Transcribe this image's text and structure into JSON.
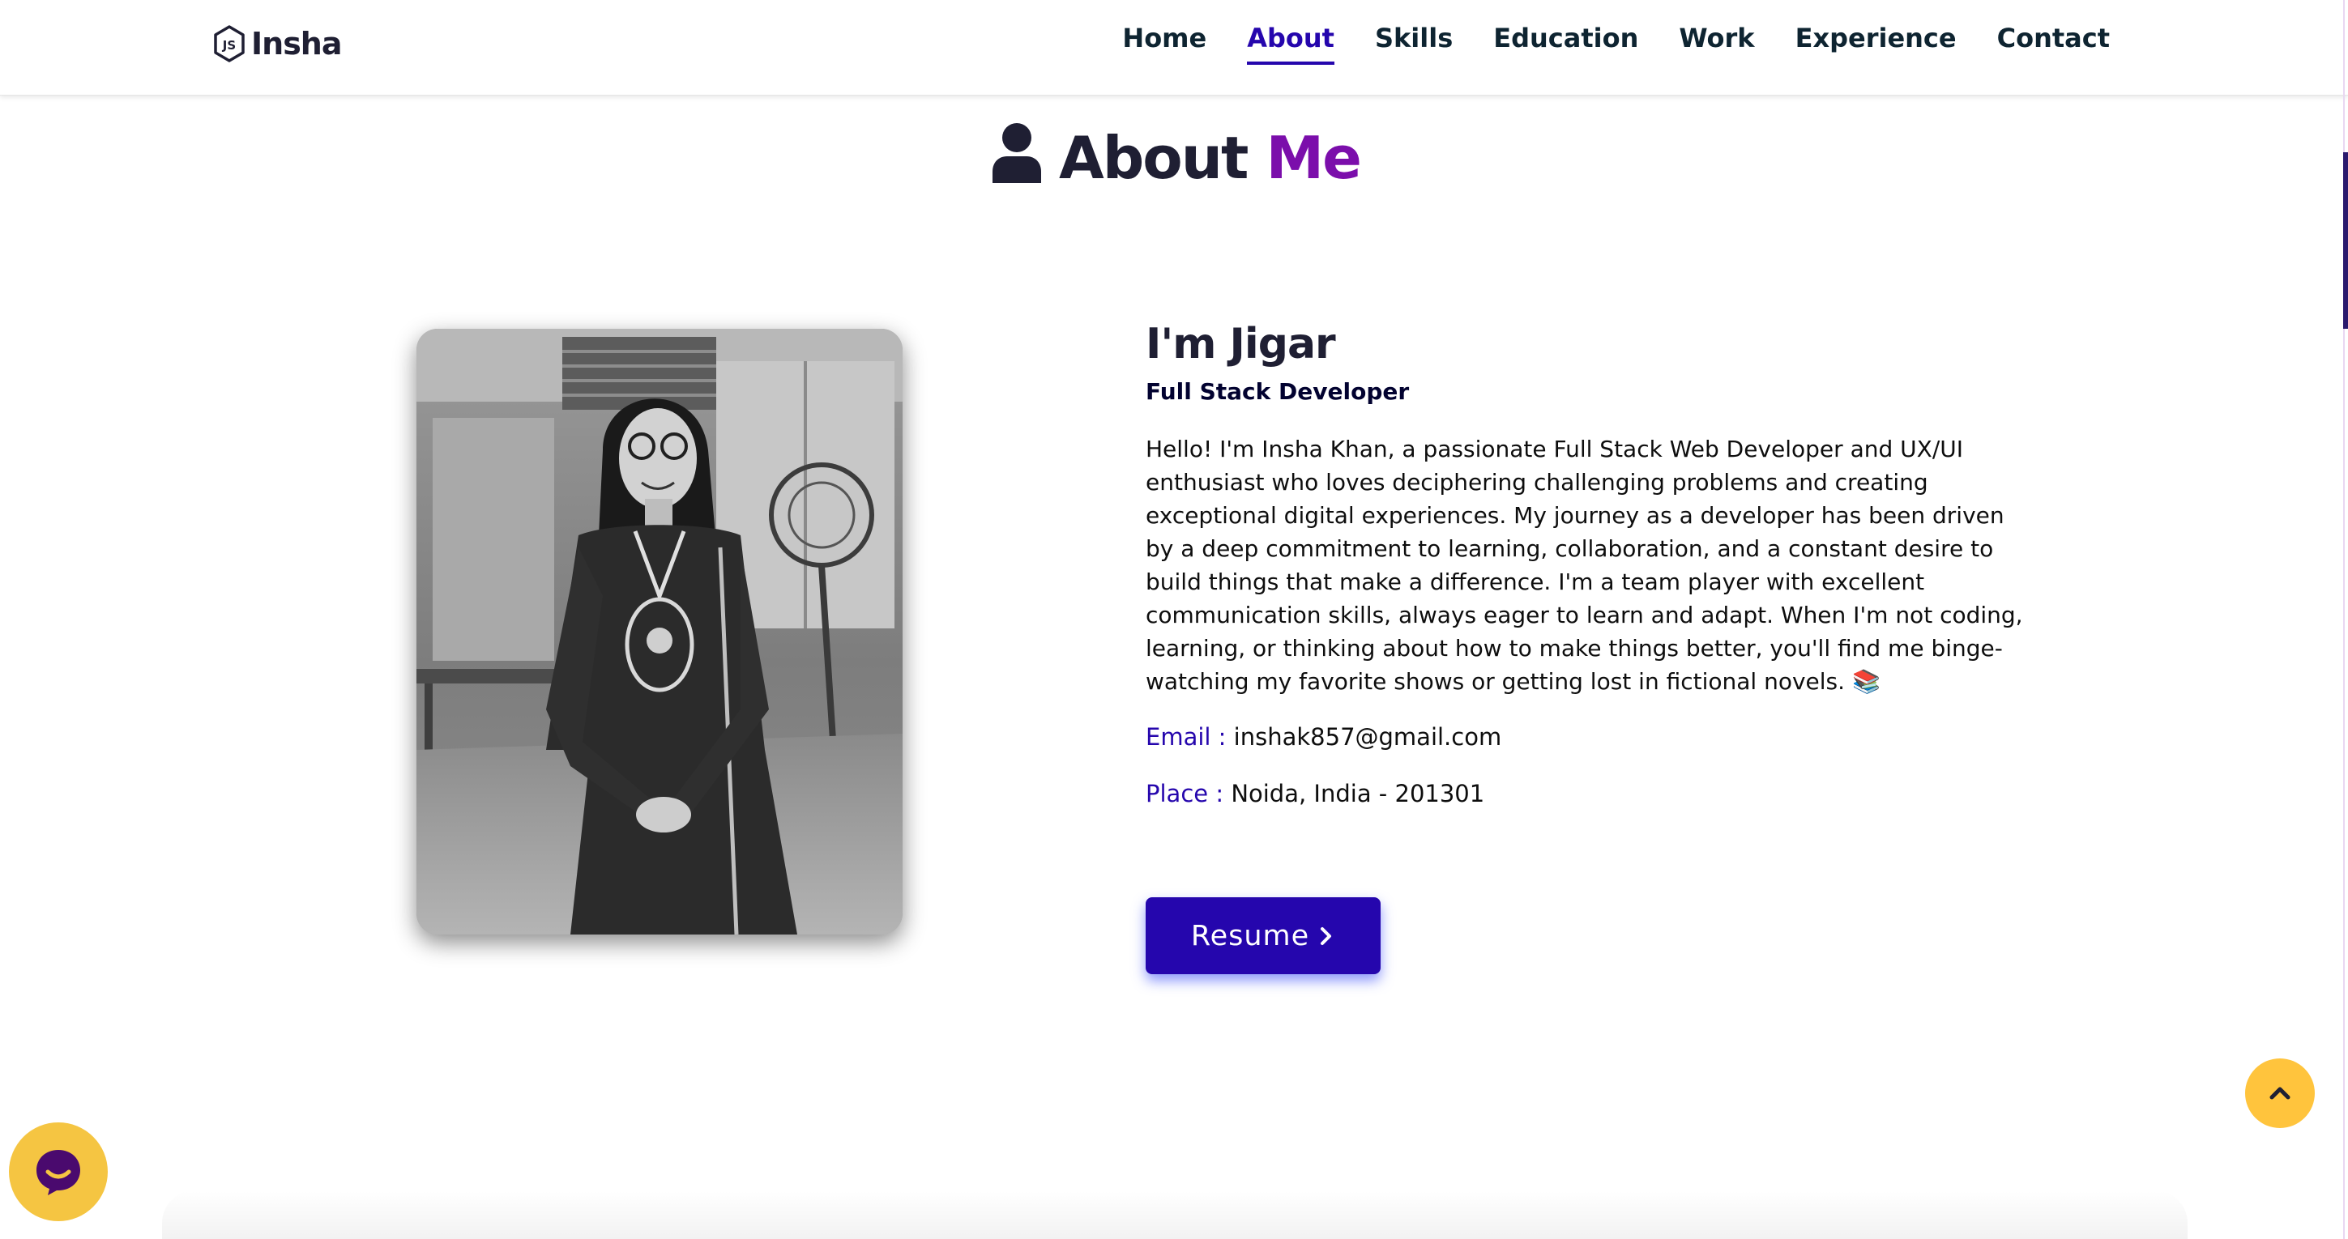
{
  "brand": {
    "name": "Insha",
    "icon": "nodejs-hexagon-icon"
  },
  "nav": {
    "items": [
      {
        "label": "Home"
      },
      {
        "label": "About"
      },
      {
        "label": "Skills"
      },
      {
        "label": "Education"
      },
      {
        "label": "Work"
      },
      {
        "label": "Experience"
      },
      {
        "label": "Contact"
      }
    ],
    "active": "About"
  },
  "about": {
    "heading_main": "About",
    "heading_accent": "Me",
    "heading_icon": "user-icon",
    "name": "I'm Jigar",
    "role": "Full Stack Developer",
    "bio": "Hello! I'm Insha Khan, a passionate Full Stack Web Developer and UX/UI enthusiast who loves deciphering challenging problems and creating exceptional digital experiences. My journey as a developer has been driven by a deep commitment to learning, collaboration, and a constant desire to build things that make a difference. I'm a team player with excellent communication skills, always eager to learn and adapt. When I'm not coding, learning, or thinking about how to make things better, you'll find me binge-watching my favorite shows or getting lost in fictional novels. 📚",
    "email_label": "Email :",
    "email_value": "inshak857@gmail.com",
    "place_label": "Place :",
    "place_value": "Noida, India - 201301",
    "resume_label": "Resume"
  },
  "floating": {
    "scroll_top_icon": "chevron-up-icon",
    "chat_icon": "chat-bubble-icon"
  },
  "colors": {
    "nav_active": "#2506ad",
    "heading_accent": "#7b0eab",
    "resume_button": "#2506ad",
    "scroll_top_button": "#ffc43d",
    "chat_button": "#f5c542",
    "chat_bubble": "#4a0a6e"
  }
}
